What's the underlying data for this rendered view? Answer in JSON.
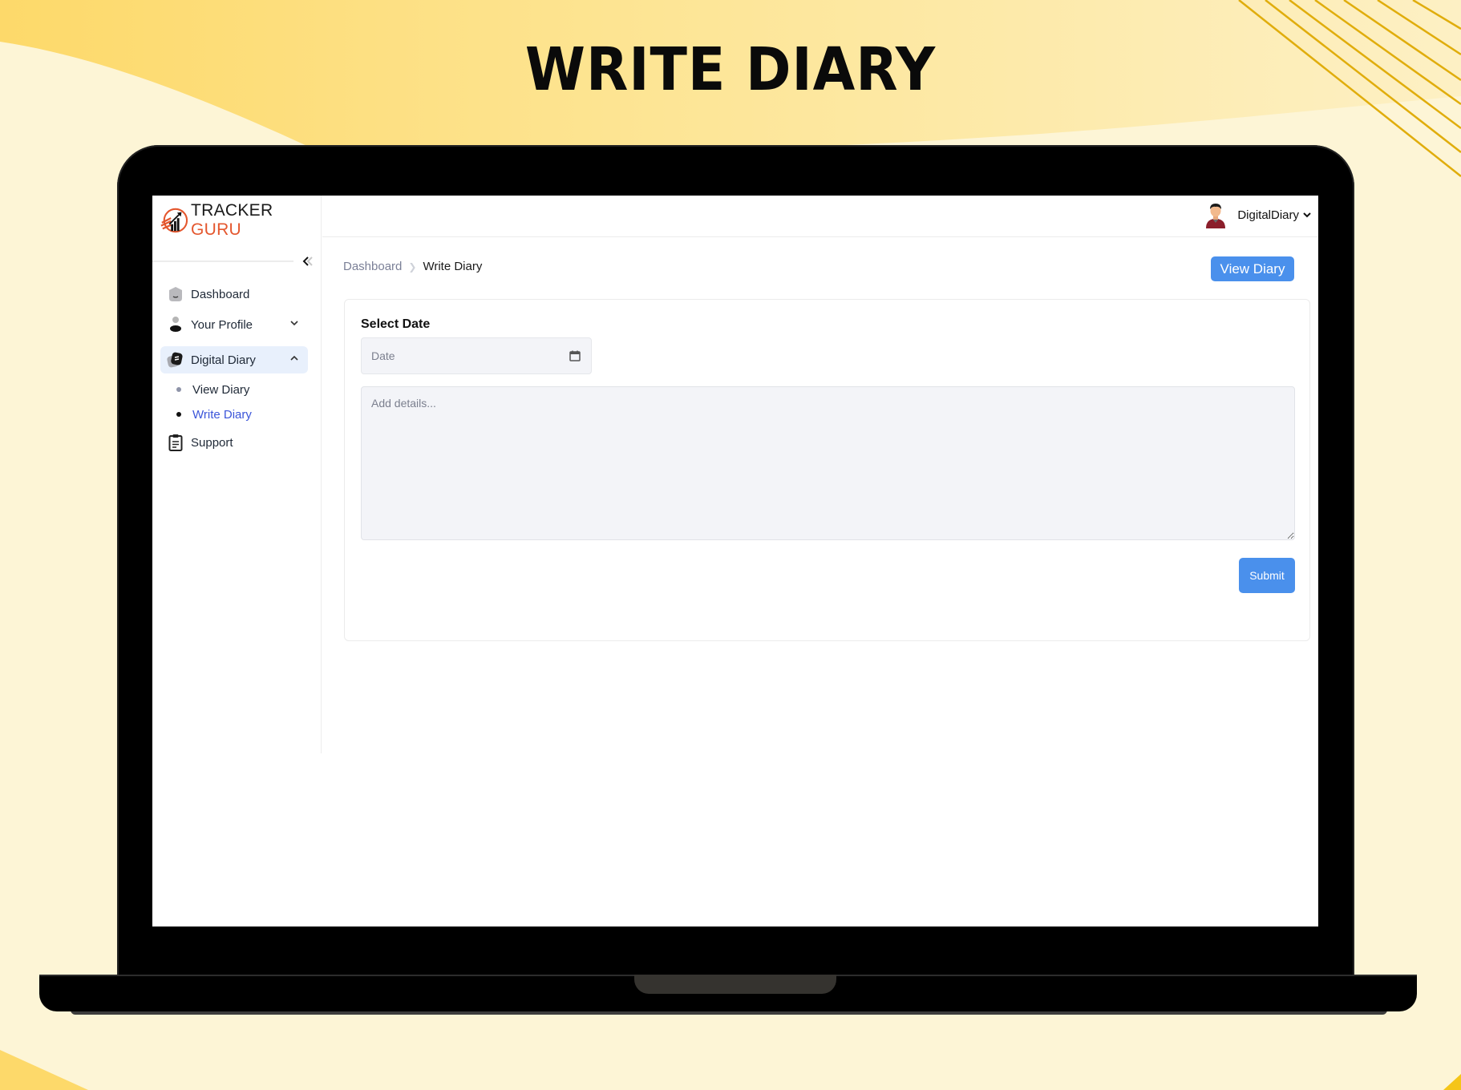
{
  "promo": {
    "title": "WRITE DIARY",
    "colors": {
      "background_light": "#fdf5d6",
      "background_gold": "#fde07e",
      "accent_lines": "#e0ad0c"
    }
  },
  "app": {
    "logo": {
      "word1": "TRACKER",
      "word2": "GURU",
      "accent_color": "#e4572e"
    },
    "user": {
      "name": "DigitalDiary",
      "avatar_icon": "user-avatar"
    },
    "sidebar": {
      "collapse_icon": "chevrons-left-icon",
      "items": [
        {
          "label": "Dashboard",
          "icon": "dashboard-icon"
        },
        {
          "label": "Your Profile",
          "icon": "person-icon",
          "expandable": true,
          "expanded": false
        },
        {
          "label": "Digital Diary",
          "icon": "diary-icon",
          "expandable": true,
          "expanded": true,
          "active": true,
          "children": [
            {
              "label": "View Diary"
            },
            {
              "label": "Write Diary",
              "current": true
            }
          ]
        },
        {
          "label": "Support",
          "icon": "clipboard-icon"
        }
      ]
    },
    "breadcrumb": {
      "home": "Dashboard",
      "current": "Write Diary"
    },
    "actions": {
      "view_diary": "View Diary"
    },
    "form": {
      "date_label": "Select Date",
      "date_placeholder": "Date",
      "date_value": "",
      "details_placeholder": "Add details...",
      "details_value": "",
      "submit_label": "Submit"
    },
    "colors": {
      "primary": "#4a90ec",
      "active_link": "#3b55d9",
      "active_bg": "#e8f0fc",
      "input_bg": "#f3f4f8"
    }
  }
}
